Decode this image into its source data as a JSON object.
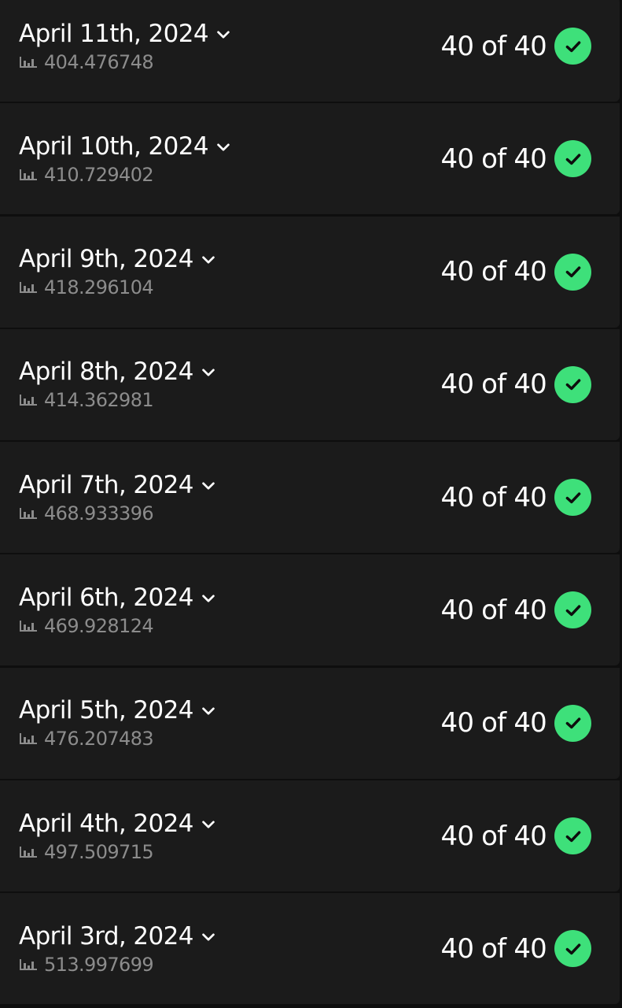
{
  "colors": {
    "background": "#0e0e0e",
    "row_background": "#1b1b1b",
    "check_green": "#3ee07a",
    "secondary_text": "#8c8c8c"
  },
  "icons": {
    "expand": "chevron-down-icon",
    "score": "bar-chart-icon",
    "status": "check-circle-icon"
  },
  "entries": [
    {
      "date": "April 11th, 2024",
      "score": "404.476748",
      "progress": "40 of 40"
    },
    {
      "date": "April 10th, 2024",
      "score": "410.729402",
      "progress": "40 of 40"
    },
    {
      "date": "April 9th, 2024",
      "score": "418.296104",
      "progress": "40 of 40"
    },
    {
      "date": "April 8th, 2024",
      "score": "414.362981",
      "progress": "40 of 40"
    },
    {
      "date": "April 7th, 2024",
      "score": "468.933396",
      "progress": "40 of 40"
    },
    {
      "date": "April 6th, 2024",
      "score": "469.928124",
      "progress": "40 of 40"
    },
    {
      "date": "April 5th, 2024",
      "score": "476.207483",
      "progress": "40 of 40"
    },
    {
      "date": "April 4th, 2024",
      "score": "497.509715",
      "progress": "40 of 40"
    },
    {
      "date": "April 3rd, 2024",
      "score": "513.997699",
      "progress": "40 of 40"
    }
  ]
}
